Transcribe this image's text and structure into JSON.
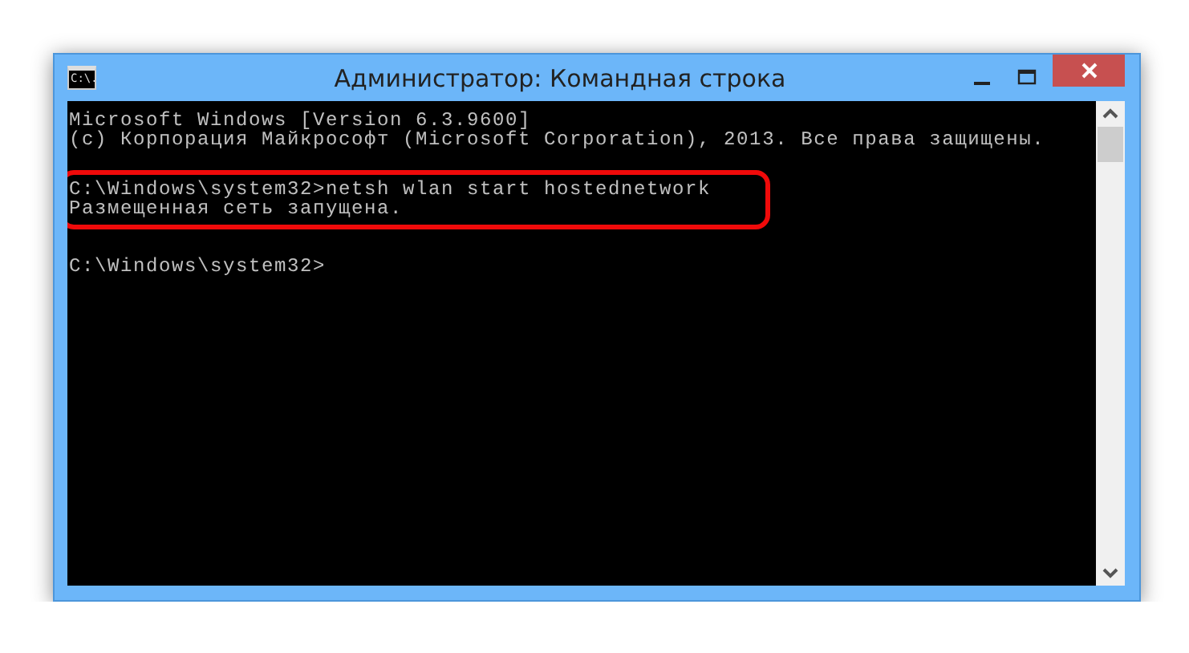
{
  "window": {
    "title": "Администратор: Командная строка",
    "icon_text": "C:\\."
  },
  "console": {
    "blocks": [
      {
        "lines": [
          "Microsoft Windows [Version 6.3.9600]",
          "(c) Корпорация Майкрософт (Microsoft Corporation), 2013. Все права защищены."
        ],
        "highlighted": false
      },
      {
        "lines": [
          "C:\\Windows\\system32>netsh wlan start hostednetwork",
          "Размещенная сеть запущена."
        ],
        "highlighted": true
      },
      {
        "lines": [
          "C:\\Windows\\system32>"
        ],
        "highlighted": false
      }
    ]
  }
}
